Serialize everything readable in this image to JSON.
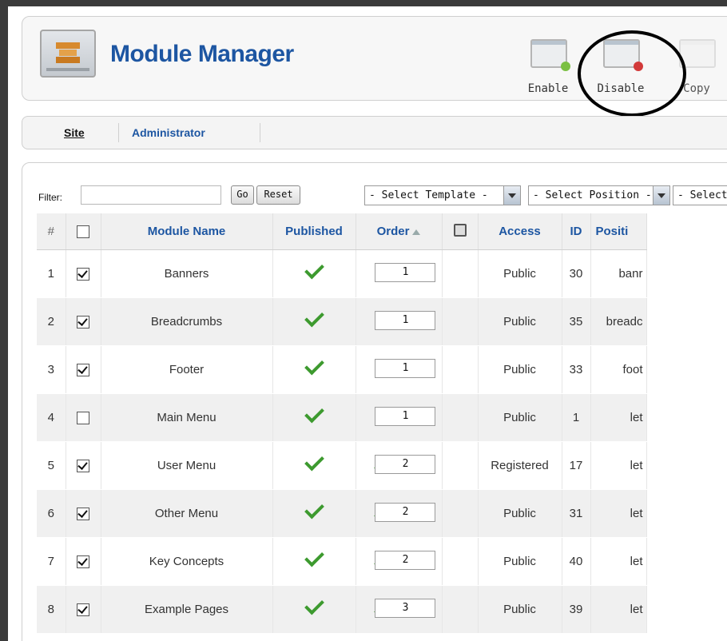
{
  "header": {
    "title": "Module Manager",
    "logo_icon": "module-manager-icon",
    "toolbar": [
      {
        "label": "Enable",
        "icon": "enable-icon"
      },
      {
        "label": "Disable",
        "icon": "disable-icon"
      },
      {
        "label": "Copy",
        "icon": "copy-icon"
      }
    ]
  },
  "submenu": {
    "items": [
      {
        "label": "Site",
        "active": true
      },
      {
        "label": "Administrator",
        "active": false
      }
    ]
  },
  "filter": {
    "label": "Filter:",
    "value": "",
    "go_label": "Go",
    "reset_label": "Reset",
    "select_template": "- Select Template -",
    "select_position": "- Select Position -",
    "select_type": "- Select"
  },
  "table": {
    "headers": {
      "num": "#",
      "name": "Module Name",
      "published": "Published",
      "order": "Order",
      "access": "Access",
      "id": "ID",
      "position": "Positi"
    },
    "rows": [
      {
        "num": "1",
        "checked": true,
        "name": "Banners",
        "order": "1",
        "up": false,
        "down": false,
        "access": "Public",
        "id": "30",
        "position": "banr"
      },
      {
        "num": "2",
        "checked": true,
        "name": "Breadcrumbs",
        "order": "1",
        "up": false,
        "down": false,
        "access": "Public",
        "id": "35",
        "position": "breadc"
      },
      {
        "num": "3",
        "checked": true,
        "name": "Footer",
        "order": "1",
        "up": false,
        "down": false,
        "access": "Public",
        "id": "33",
        "position": "foot"
      },
      {
        "num": "4",
        "checked": false,
        "name": "Main Menu",
        "order": "1",
        "up": false,
        "down": true,
        "access": "Public",
        "id": "1",
        "position": "let"
      },
      {
        "num": "5",
        "checked": true,
        "name": "User Menu",
        "order": "2",
        "up": true,
        "down": true,
        "access": "Registered",
        "id": "17",
        "position": "let"
      },
      {
        "num": "6",
        "checked": true,
        "name": "Other Menu",
        "order": "2",
        "up": true,
        "down": true,
        "access": "Public",
        "id": "31",
        "position": "let"
      },
      {
        "num": "7",
        "checked": true,
        "name": "Key Concepts",
        "order": "2",
        "up": true,
        "down": true,
        "access": "Public",
        "id": "40",
        "position": "let"
      },
      {
        "num": "8",
        "checked": true,
        "name": "Example Pages",
        "order": "3",
        "up": true,
        "down": true,
        "access": "Public",
        "id": "39",
        "position": "let"
      }
    ]
  },
  "colors": {
    "title": "#1d56a2",
    "public": "#3d8a2f",
    "registered": "#cc2222",
    "frame": "#3b3b3b"
  }
}
